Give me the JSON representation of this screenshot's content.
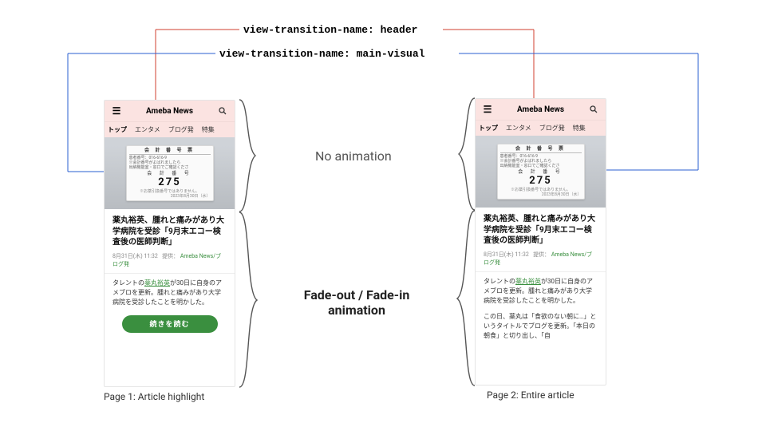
{
  "labels": {
    "header_transition": "view-transition-name: header",
    "mainvisual_transition": "view-transition-name: main-visual"
  },
  "annotations": {
    "no_animation": "No animation",
    "fade_animation_line1": "Fade-out / Fade-in",
    "fade_animation_line2": "animation"
  },
  "captions": {
    "page1": "Page 1: Article highlight",
    "page2": "Page 2: Entire article"
  },
  "phone_common": {
    "brand": "Ameba News",
    "nav": [
      "トップ",
      "エンタメ",
      "ブログ発",
      "特集"
    ],
    "ticket": {
      "title": "会 計 番 号 票",
      "line1": "患者番号：016-616-9",
      "line2": "※会計番号がよばれましたら\n出納機能室・窓口でご確認くださ",
      "label": "会 計 番 号",
      "number": "275",
      "note": "※お薬引換番号ではありません。",
      "date": "2023年8月30日（水）"
    },
    "article_title": "薬丸裕英、腫れと痛みがあり大学病院を受診「9月末エコー検査後の医師判断」",
    "meta_time": "8月31日(木) 11:32",
    "meta_provider": "提供：",
    "meta_source": "Ameba News/ブログ発",
    "body_prefix": "タレントの",
    "body_link": "薬丸裕英",
    "body_after": "が30日に自身のアメブロを更新。腫れと痛みがあり大学病院を受診したことを明かした。"
  },
  "phone1": {
    "read_more": "続きを読む"
  },
  "phone2": {
    "body_extra": "この日、薬丸は「食欲のない朝に…」というタイトルでブログを更新。「本日の朝食」と切り出し、「自"
  }
}
